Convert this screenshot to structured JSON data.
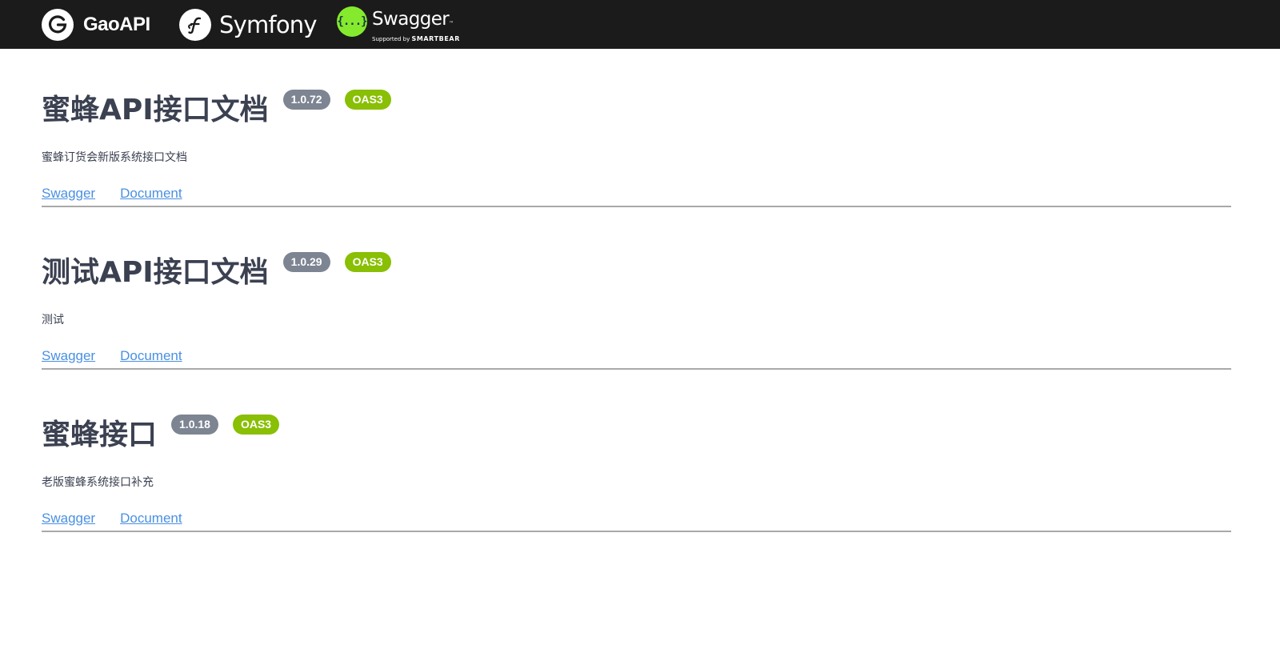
{
  "header": {
    "brands": [
      {
        "icon": "gaoapi-g-logo-icon",
        "name": "GaoAPI"
      },
      {
        "icon": "symfony-sf-logo-icon",
        "name": "Symfony"
      },
      {
        "icon": "swagger-braces-logo-icon",
        "glyph": "{...}",
        "name": "Swagger",
        "tagline_prefix": "Supported by",
        "tagline_brand": "SMARTBEAR"
      }
    ]
  },
  "apis": [
    {
      "title": "蜜蜂API接口文档",
      "version": "1.0.72",
      "spec": "OAS3",
      "description": "蜜蜂订货会新版系统接口文档",
      "links": [
        "Swagger",
        "Document"
      ]
    },
    {
      "title": "测试API接口文档",
      "version": "1.0.29",
      "spec": "OAS3",
      "description": "测试",
      "links": [
        "Swagger",
        "Document"
      ]
    },
    {
      "title": "蜜蜂接口",
      "version": "1.0.18",
      "spec": "OAS3",
      "description": "老版蜜蜂系统接口补充",
      "links": [
        "Swagger",
        "Document"
      ]
    }
  ],
  "colors": {
    "topbar_bg": "#1b1b1b",
    "title_text": "#3b4151",
    "version_badge": "#7d8492",
    "oas_badge": "#89bf04",
    "link": "#4990e2",
    "swagger_green": "#85ea2d"
  }
}
